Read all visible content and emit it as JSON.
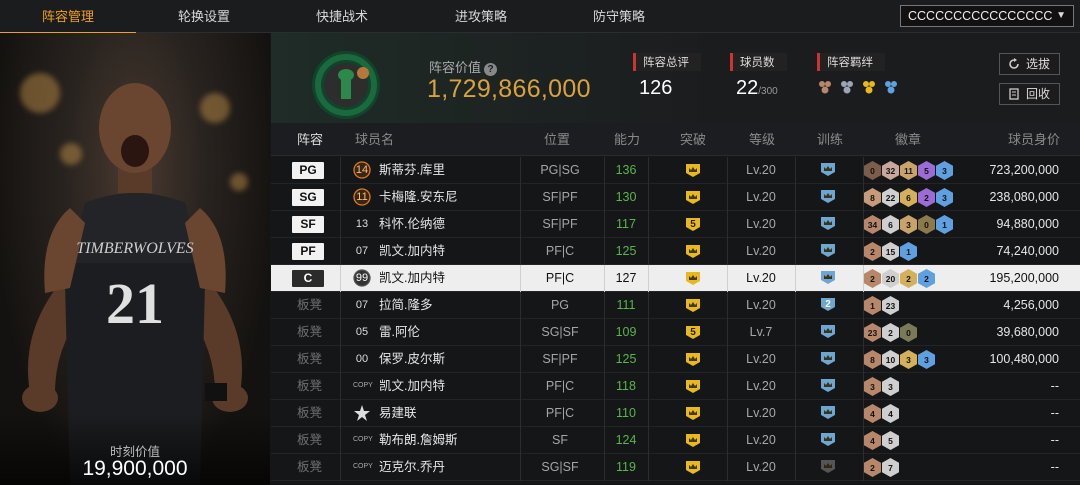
{
  "nav": {
    "tabs": [
      "阵容管理",
      "轮换设置",
      "快捷战术",
      "进攻策略",
      "防守策略"
    ],
    "active": 0,
    "lineup_name": "CCCCCCCCCCCCCCCC"
  },
  "left": {
    "moment_label": "时刻价值",
    "moment_value": "19,900,000"
  },
  "info": {
    "value_label": "阵容价值",
    "value": "1,729,866,000",
    "overall_label": "阵容总评",
    "overall": "126",
    "players_label": "球员数",
    "players": "22",
    "players_max": "/300",
    "chem_label": "阵容羁绊",
    "select_btn": "选拔",
    "recycle_btn": "回收"
  },
  "table": {
    "headers": [
      "阵容",
      "球员名",
      "位置",
      "能力",
      "突破",
      "等级",
      "训练",
      "徽章",
      "球员身价"
    ],
    "rows": [
      {
        "slot": "PG",
        "starter": true,
        "num": "14",
        "name": "斯蒂芬.库里",
        "pos": "PG|SG",
        "ability": "136",
        "brk": "crown",
        "lvl": "Lv.20",
        "train": "crown",
        "badges": [
          [
            "0",
            "#7a5e4a"
          ],
          [
            "32",
            "#c7a89a"
          ],
          [
            "11",
            "#c9a46a"
          ],
          [
            "5",
            "#9b6bd6"
          ],
          [
            "3",
            "#5ea0e0"
          ]
        ],
        "salary": "723,200,000"
      },
      {
        "slot": "SG",
        "starter": true,
        "num": "11",
        "name": "卡梅隆.安东尼",
        "pos": "SF|PF",
        "ability": "130",
        "brk": "crown",
        "lvl": "Lv.20",
        "train": "crown",
        "badges": [
          [
            "8",
            "#c89a7a"
          ],
          [
            "22",
            "#cfcfcf"
          ],
          [
            "6",
            "#d4b05a"
          ],
          [
            "2",
            "#9b6bd6"
          ],
          [
            "3",
            "#5ea0e0"
          ]
        ],
        "salary": "238,080,000"
      },
      {
        "slot": "SF",
        "starter": true,
        "num": "13",
        "name": "科怀.伦纳德",
        "pos": "SF|PF",
        "ability": "117",
        "brk": "5",
        "lvl": "Lv.20",
        "train": "crown",
        "badges": [
          [
            "34",
            "#b8876a"
          ],
          [
            "6",
            "#cfcfcf"
          ],
          [
            "3",
            "#c9a46a"
          ],
          [
            "0",
            "#8c7a4a"
          ],
          [
            "1",
            "#5ea0e0"
          ]
        ],
        "salary": "94,880,000"
      },
      {
        "slot": "PF",
        "starter": true,
        "num": "07",
        "name": "凯文.加内特",
        "pos": "PF|C",
        "ability": "125",
        "brk": "crown",
        "lvl": "Lv.20",
        "train": "crown",
        "badges": [
          [
            "2",
            "#b8876a"
          ],
          [
            "15",
            "#cfcfcf"
          ],
          [
            "1",
            "#5ea0e0"
          ]
        ],
        "salary": "74,240,000"
      },
      {
        "slot": "C",
        "starter": true,
        "selected": true,
        "num": "99",
        "name": "凯文.加内特",
        "pos": "PF|C",
        "ability": "127",
        "brk": "crown",
        "lvl": "Lv.20",
        "train": "crown",
        "badges": [
          [
            "2",
            "#b8876a"
          ],
          [
            "20",
            "#cfcfcf"
          ],
          [
            "2",
            "#d4b05a"
          ],
          [
            "2",
            "#5ea0e0"
          ]
        ],
        "salary": "195,200,000"
      },
      {
        "slot": "板凳",
        "starter": false,
        "num": "07",
        "name": "拉简.隆多",
        "pos": "PG",
        "ability": "111",
        "brk": "crown",
        "lvl": "Lv.20",
        "train": "2",
        "badges": [
          [
            "1",
            "#b8876a"
          ],
          [
            "23",
            "#cfcfcf"
          ]
        ],
        "salary": "4,256,000"
      },
      {
        "slot": "板凳",
        "starter": false,
        "num": "05",
        "name": "雷.阿伦",
        "pos": "SG|SF",
        "ability": "109",
        "brk": "5",
        "lvl": "Lv.7",
        "train": "crown",
        "badges": [
          [
            "23",
            "#b8876a"
          ],
          [
            "2",
            "#cfcfcf"
          ],
          [
            "0",
            "#7a7a5a"
          ]
        ],
        "salary": "39,680,000"
      },
      {
        "slot": "板凳",
        "starter": false,
        "num": "00",
        "name": "保罗.皮尔斯",
        "pos": "SF|PF",
        "ability": "125",
        "brk": "crown",
        "lvl": "Lv.20",
        "train": "crown",
        "badges": [
          [
            "8",
            "#b8876a"
          ],
          [
            "10",
            "#cfcfcf"
          ],
          [
            "3",
            "#d4b05a"
          ],
          [
            "3",
            "#5ea0e0"
          ]
        ],
        "salary": "100,480,000"
      },
      {
        "slot": "板凳",
        "starter": false,
        "num": "COPY",
        "name": "凯文.加内特",
        "pos": "PF|C",
        "ability": "118",
        "brk": "crown",
        "lvl": "Lv.20",
        "train": "crown",
        "badges": [
          [
            "3",
            "#b8876a"
          ],
          [
            "3",
            "#cfcfcf"
          ]
        ],
        "salary": "--"
      },
      {
        "slot": "板凳",
        "starter": false,
        "num": "star",
        "name": "易建联",
        "pos": "PF|C",
        "ability": "110",
        "brk": "crown",
        "lvl": "Lv.20",
        "train": "crown",
        "badges": [
          [
            "4",
            "#b8876a"
          ],
          [
            "4",
            "#cfcfcf"
          ]
        ],
        "salary": "--"
      },
      {
        "slot": "板凳",
        "starter": false,
        "num": "COPY",
        "name": "勒布朗.詹姆斯",
        "pos": "SF",
        "ability": "124",
        "brk": "crown",
        "lvl": "Lv.20",
        "train": "crown",
        "badges": [
          [
            "4",
            "#b8876a"
          ],
          [
            "5",
            "#cfcfcf"
          ]
        ],
        "salary": "--"
      },
      {
        "slot": "板凳",
        "starter": false,
        "num": "COPY",
        "name": "迈克尔.乔丹",
        "pos": "SG|SF",
        "ability": "119",
        "brk": "crown",
        "lvl": "Lv.20",
        "train": "gray",
        "badges": [
          [
            "2",
            "#b8876a"
          ],
          [
            "7",
            "#cfcfcf"
          ]
        ],
        "salary": "--"
      }
    ]
  },
  "colors": {
    "accent": "#f0a020",
    "value_gold": "#d9a23d",
    "ability_green": "#5ab54b",
    "badge_gold": "#e8b820",
    "train_blue": "#6fa6cf"
  }
}
